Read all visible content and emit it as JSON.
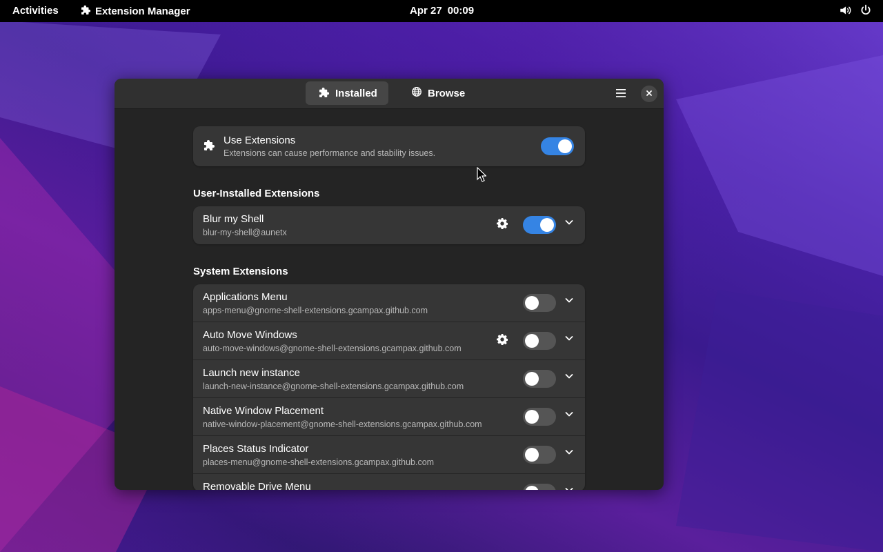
{
  "topbar": {
    "activities": "Activities",
    "app_name": "Extension Manager",
    "date": "Apr 27",
    "time": "00:09"
  },
  "window": {
    "tabs": [
      {
        "label": "Installed",
        "icon": "puzzle-icon",
        "active": true
      },
      {
        "label": "Browse",
        "icon": "globe-icon",
        "active": false
      }
    ],
    "use_extensions": {
      "title": "Use Extensions",
      "subtitle": "Extensions can cause performance and stability issues.",
      "enabled": true
    },
    "sections": {
      "user_title": "User-Installed Extensions",
      "system_title": "System Extensions"
    },
    "user_extensions": [
      {
        "name": "Blur my Shell",
        "uuid": "blur-my-shell@aunetx",
        "has_settings": true,
        "enabled": true
      }
    ],
    "system_extensions": [
      {
        "name": "Applications Menu",
        "uuid": "apps-menu@gnome-shell-extensions.gcampax.github.com",
        "has_settings": false,
        "enabled": false
      },
      {
        "name": "Auto Move Windows",
        "uuid": "auto-move-windows@gnome-shell-extensions.gcampax.github.com",
        "has_settings": true,
        "enabled": false
      },
      {
        "name": "Launch new instance",
        "uuid": "launch-new-instance@gnome-shell-extensions.gcampax.github.com",
        "has_settings": false,
        "enabled": false
      },
      {
        "name": "Native Window Placement",
        "uuid": "native-window-placement@gnome-shell-extensions.gcampax.github.com",
        "has_settings": false,
        "enabled": false
      },
      {
        "name": "Places Status Indicator",
        "uuid": "places-menu@gnome-shell-extensions.gcampax.github.com",
        "has_settings": false,
        "enabled": false
      },
      {
        "name": "Removable Drive Menu",
        "uuid": "",
        "has_settings": false,
        "enabled": false
      }
    ]
  },
  "colors": {
    "accent": "#3584e4",
    "window_bg": "#242424",
    "card_bg": "#363636",
    "headerbar_bg": "#303030"
  }
}
